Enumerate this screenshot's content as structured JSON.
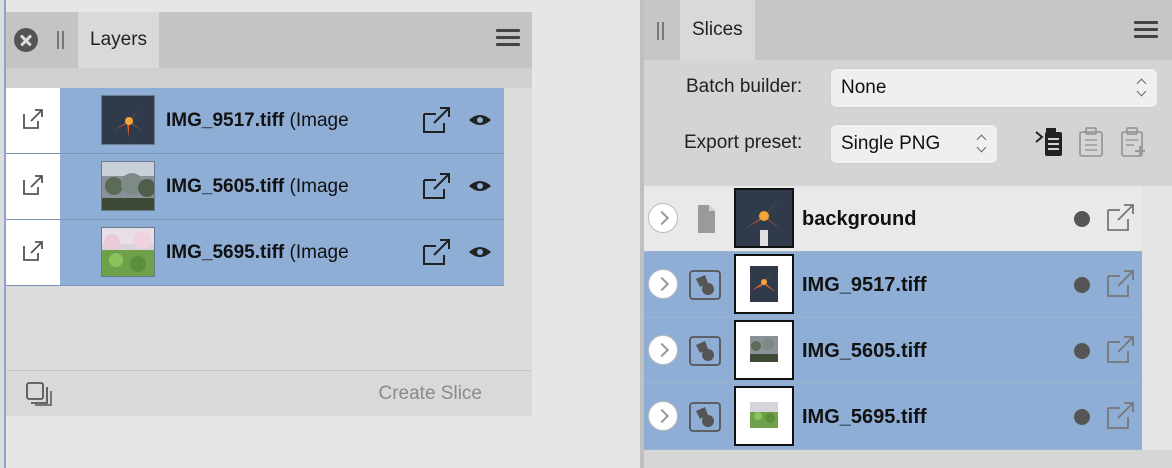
{
  "layers_panel": {
    "tab_label": "Layers",
    "layers": [
      {
        "name": "IMG_9517.tiff",
        "suffix": "(Image"
      },
      {
        "name": "IMG_5605.tiff",
        "suffix": "(Image"
      },
      {
        "name": "IMG_5695.tiff",
        "suffix": "(Image"
      }
    ],
    "create_slice_label": "Create Slice"
  },
  "slices_panel": {
    "tab_label": "Slices",
    "batch_builder_label": "Batch builder:",
    "batch_builder_value": "None",
    "export_preset_label": "Export preset:",
    "export_preset_value": "Single PNG",
    "slices": [
      {
        "name": "background",
        "selected": false
      },
      {
        "name": "IMG_9517.tiff",
        "selected": true
      },
      {
        "name": "IMG_5605.tiff",
        "selected": true
      },
      {
        "name": "IMG_5695.tiff",
        "selected": true
      }
    ]
  },
  "colors": {
    "selection": "#8faed6",
    "panel_bg": "#e6e6e6",
    "tab_bar": "#c4c4c4"
  },
  "icons": {
    "close": "close-icon",
    "grip": "grip-icon",
    "menu": "hamburger-menu-icon",
    "export": "export-arrow-icon",
    "visibility": "eye-icon",
    "stack": "stack-copy-icon",
    "disclosure": "chevron-right-icon",
    "document": "document-icon",
    "layer_shape": "shape-layer-icon"
  }
}
